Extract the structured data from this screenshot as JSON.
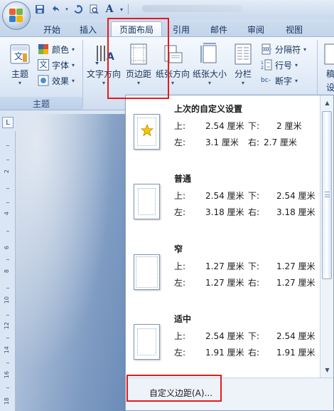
{
  "quick_access": {
    "icons": [
      "save-icon",
      "undo-icon",
      "redo-icon",
      "print-preview-icon",
      "font-a-icon",
      "customize-dropdown-icon"
    ]
  },
  "tabs": [
    {
      "label": "开始",
      "active": false
    },
    {
      "label": "插入",
      "active": false
    },
    {
      "label": "页面布局",
      "active": true
    },
    {
      "label": "引用",
      "active": false
    },
    {
      "label": "邮件",
      "active": false
    },
    {
      "label": "审阅",
      "active": false
    },
    {
      "label": "视图",
      "active": false
    }
  ],
  "ribbon": {
    "theme_group": {
      "label": "主题",
      "themes_button": "主题",
      "colors_button": "颜色",
      "fonts_button": "字体",
      "effects_button": "效果"
    },
    "page_setup": {
      "text_direction": "文字方向",
      "margins": "页边距",
      "orientation": "纸张方向",
      "size": "纸张大小",
      "columns": "分栏",
      "breaks": "分隔符",
      "line_numbers": "行号",
      "hyphenation": "断字"
    },
    "cut_off": {
      "line1": "稿",
      "line2": "设"
    }
  },
  "ruler": {
    "corner_label": "L",
    "numbers": [
      "2",
      "4",
      "6",
      "8",
      "10",
      "12",
      "14",
      "16",
      "18"
    ]
  },
  "margins_menu": {
    "presets": [
      {
        "title": "上次的自定义设置",
        "top_label": "上:",
        "top": "2.54 厘米",
        "bottom_label": "下:",
        "bottom": "2 厘米",
        "left_label": "左:",
        "left": "3.1 厘米",
        "right_label": "右:",
        "right": "2.7 厘米",
        "icon": "star-icon"
      },
      {
        "title": "普通",
        "top_label": "上:",
        "top": "2.54 厘米",
        "bottom_label": "下:",
        "bottom": "2.54 厘米",
        "left_label": "左:",
        "left": "3.18 厘米",
        "right_label": "右:",
        "right": "3.18 厘米"
      },
      {
        "title": "窄",
        "top_label": "上:",
        "top": "1.27 厘米",
        "bottom_label": "下:",
        "bottom": "1.27 厘米",
        "left_label": "左:",
        "left": "1.27 厘米",
        "right_label": "右:",
        "right": "1.27 厘米"
      },
      {
        "title": "适中",
        "top_label": "上:",
        "top": "2.54 厘米",
        "bottom_label": "下:",
        "bottom": "2.54 厘米",
        "left_label": "左:",
        "left": "1.91 厘米",
        "right_label": "右:",
        "right": "1.91 厘米"
      }
    ],
    "custom_margins": "自定义边距(A)..."
  },
  "colors": {
    "highlight_box": "#e51b1b",
    "selected_button": "#ffd35c",
    "star": "#f7c600"
  }
}
